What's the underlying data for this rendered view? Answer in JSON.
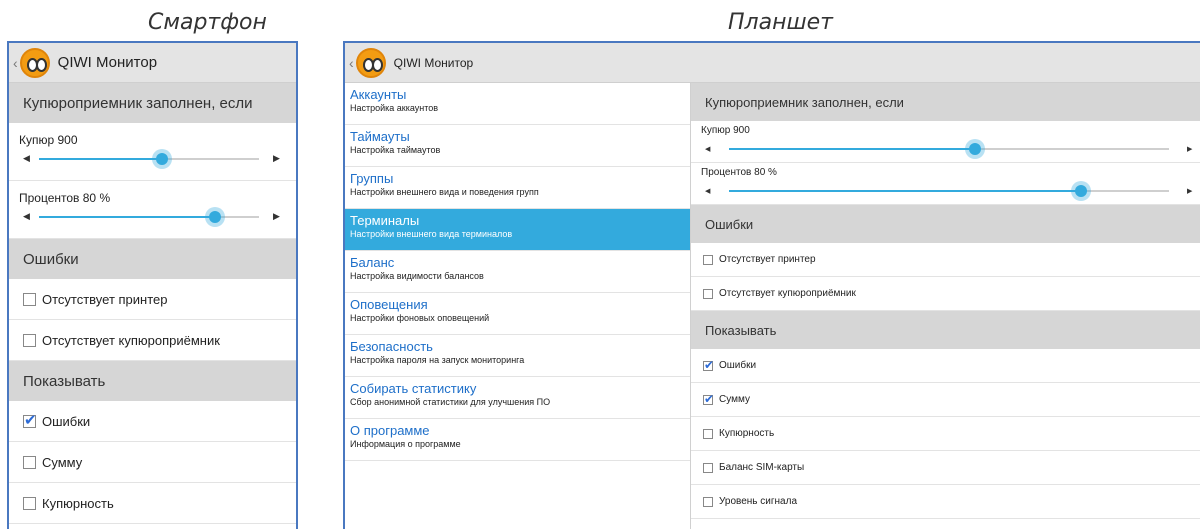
{
  "captions": {
    "phone": "Смартфон",
    "tablet": "Планшет"
  },
  "app": {
    "title": "QIWI Монитор",
    "back_glyph": "‹"
  },
  "settings": {
    "section_bill": "Купюроприемник заполнен, если",
    "bill_slider": {
      "label": "Купюр  900",
      "value_fraction": 0.56,
      "left_arrow": "◀",
      "right_arrow": "▶"
    },
    "percent_slider": {
      "label": "Процентов  80 %",
      "value_fraction": 0.8,
      "left_arrow": "◀",
      "right_arrow": "▶"
    },
    "section_errors": "Ошибки",
    "errors": [
      {
        "label": "Отсутствует принтер",
        "checked": false
      },
      {
        "label": "Отсутствует купюроприёмник",
        "checked": false
      }
    ],
    "section_show": "Показывать",
    "show": [
      {
        "label": "Ошибки",
        "checked": true
      },
      {
        "label": "Сумму",
        "checked": true
      },
      {
        "label": "Купюрность",
        "checked": false
      },
      {
        "label": "Баланс SIM-карты",
        "checked": false
      },
      {
        "label": "Уровень сигнала",
        "checked": false
      }
    ],
    "phone_show": [
      {
        "label": "Ошибки",
        "checked": true
      },
      {
        "label": "Сумму",
        "checked": false
      },
      {
        "label": "Купюрность",
        "checked": false
      }
    ]
  },
  "menu": [
    {
      "title": "Аккаунты",
      "sub": "Настройка аккаунтов",
      "active": false
    },
    {
      "title": "Таймауты",
      "sub": "Настройка таймаутов",
      "active": false
    },
    {
      "title": "Группы",
      "sub": "Настройки внешнего вида и поведения групп",
      "active": false
    },
    {
      "title": "Терминалы",
      "sub": "Настройки внешнего вида терминалов",
      "active": true
    },
    {
      "title": "Баланс",
      "sub": "Настройка видимости балансов",
      "active": false
    },
    {
      "title": "Оповещения",
      "sub": "Настройки фоновых оповещений",
      "active": false
    },
    {
      "title": "Безопасность",
      "sub": "Настройка пароля на запуск мониторинга",
      "active": false
    },
    {
      "title": "Собирать статистику",
      "sub": "Сбор анонимной статистики для улучшения ПО",
      "active": false
    },
    {
      "title": "О программе",
      "sub": "Информация о программе",
      "active": false
    }
  ],
  "colors": {
    "accent": "#33aadd",
    "link": "#1e6fc9",
    "section_bg": "#d6d6d6",
    "frame": "#4a78c0"
  }
}
